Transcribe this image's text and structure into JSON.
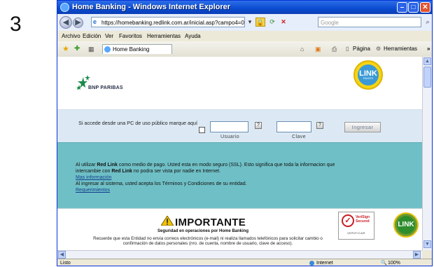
{
  "step_number": "3",
  "window": {
    "title": "Home Banking - Windows Internet Explorer"
  },
  "address_bar": {
    "url": "https://homebanking.redlink.com.ar/inicial.asp?campo4=02668campo5=",
    "search_placeholder": "Google"
  },
  "menu": {
    "items": [
      "Archivo",
      "Edición",
      "Ver",
      "Favoritos",
      "Herramientas",
      "Ayuda"
    ]
  },
  "toolbar": {
    "tab_label": "Home Banking",
    "pagina_label": "Página",
    "herramientas_label": "Herramientas"
  },
  "page": {
    "bank_name": "BNP PARIBAS",
    "link_logo_text": "LINK",
    "link_logo_sub": "PAGOS",
    "public_pc_question": "Si accede desde una PC de uso público marque aquí",
    "usuario_label": "Usuario",
    "clave_label": "Clave",
    "ingresar_label": "Ingresar",
    "help_glyph": "?",
    "info": {
      "line1_a": "Al utilizar ",
      "line1_bold": "Red Link",
      "line1_b": " como medio de pago. Usted esta en modo seguro (SSL). Esto significa que toda la informacion que",
      "line2_a": "intercambie con ",
      "line2_bold": "Red Link",
      "line2_b": " no podra ser vista por nadie en Internet.",
      "mas_info_link": "Mas información",
      "terms_text": "Al ingresar al sistema, usted acepta los Términos y Condiciones de su entidad.",
      "requisitos_link": "Requerimientos"
    },
    "importante": {
      "title": "IMPORTANTE",
      "subtitle": "Seguridad en operaciones por Home Banking",
      "text": "Recuerde que esta Entidad no envia correos electrónicos (e-mail) ni realiza llamados telefónicos para solicitar cambio o confirmación de datos personales (nro. de cuenta, nombre de usuario, clave de acceso)."
    },
    "verisign_title": "VeriSign Secured",
    "verisign_sub": "VERIFICAR"
  },
  "status_bar": {
    "left_text": "Listo",
    "zone_text": "Internet",
    "zoom_text": "100%"
  },
  "colors": {
    "login_band": "#dce9f4",
    "info_band": "#6fc0c6",
    "titlebar": "#0a4bd0"
  }
}
